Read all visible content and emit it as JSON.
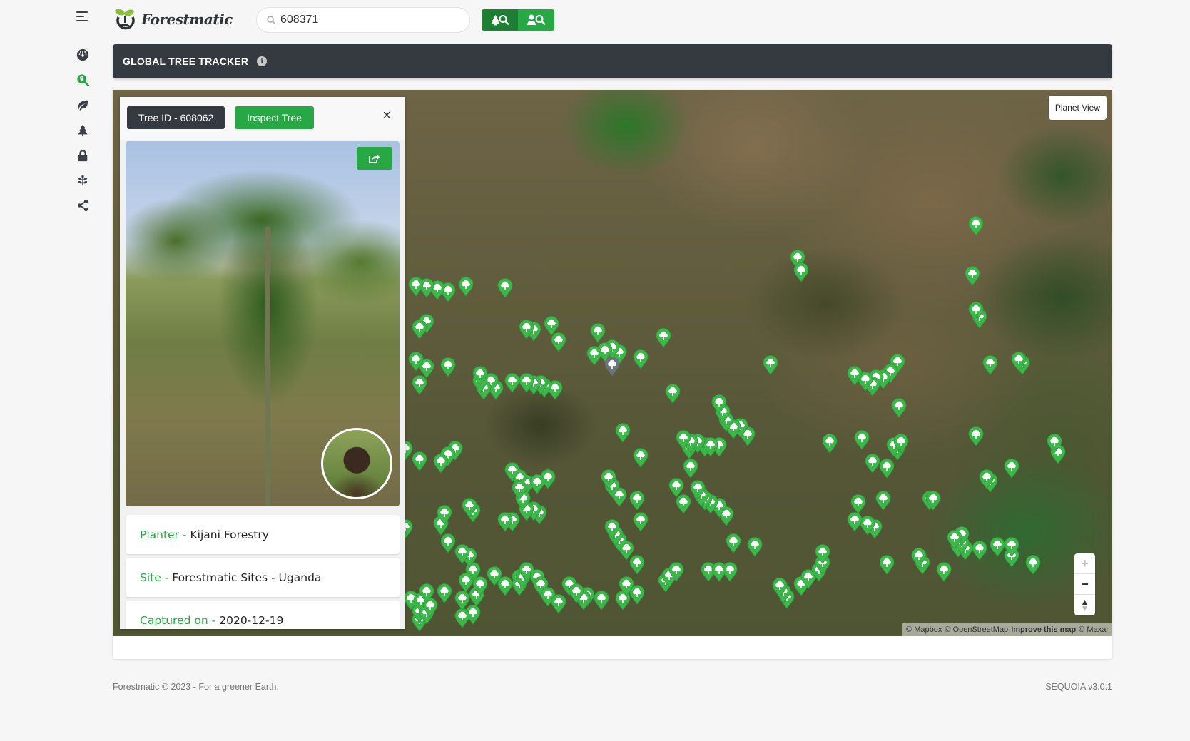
{
  "brand": {
    "name": "Forestmatic",
    "accent": "#28a745",
    "dark": "#343a40"
  },
  "sidebar": {
    "toggle_icon": "hamburger-icon",
    "items": [
      {
        "name": "dashboard",
        "icon": "speedometer-icon",
        "active": false
      },
      {
        "name": "tree-tracker",
        "icon": "search-location-icon",
        "active": true
      },
      {
        "name": "leaf",
        "icon": "leaf-icon",
        "active": false
      },
      {
        "name": "trees",
        "icon": "tree-icon",
        "active": false
      },
      {
        "name": "lock",
        "icon": "lock-icon",
        "active": false
      },
      {
        "name": "seedling",
        "icon": "seedling-icon",
        "active": false
      },
      {
        "name": "share",
        "icon": "share-icon",
        "active": false
      }
    ]
  },
  "search": {
    "value": "608371",
    "icon": "search-icon"
  },
  "search_buttons": [
    {
      "name": "search-tree",
      "icon": "tree-search-icon"
    },
    {
      "name": "search-planter",
      "icon": "user-search-icon"
    }
  ],
  "header": {
    "title": "GLOBAL TREE TRACKER",
    "info_icon": "i"
  },
  "map": {
    "planet_view_label": "Planet View",
    "zoom_in": "+",
    "zoom_out": "−",
    "compass": "▲",
    "attribution": {
      "mapbox": "© Mapbox",
      "osm": "© OpenStreetMap",
      "improve": "Improve this map",
      "maxar": "© Maxar"
    }
  },
  "tree_panel": {
    "tree_id_label": "Tree ID - 608062",
    "inspect_label": "Inspect Tree",
    "close": "×",
    "fields": [
      {
        "label": "Planter -",
        "value": "Kijani Forestry"
      },
      {
        "label": "Site -",
        "value": "Forestmatic Sites - Uganda"
      },
      {
        "label": "Captured on -",
        "value": "2020-12-19"
      }
    ]
  },
  "footer": {
    "copyright": "Forestmatic © 2023 - For a greener Earth.",
    "version": "SEQUOIA v3.0.1"
  }
}
